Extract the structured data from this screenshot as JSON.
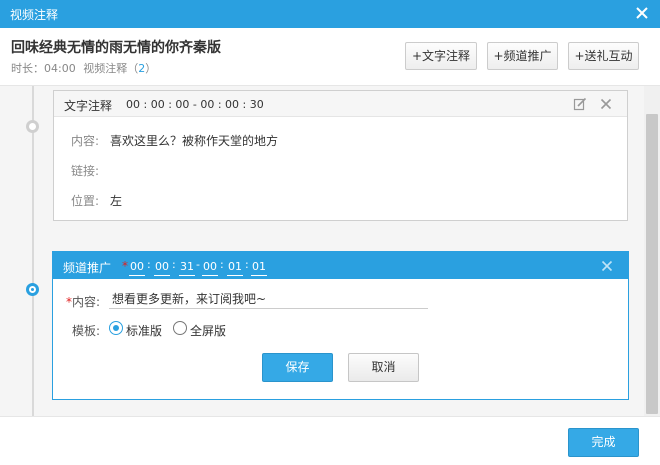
{
  "dialog": {
    "title": "视频注释",
    "close_icon": "close-icon"
  },
  "header": {
    "video_title": "回味经典无情的雨无情的你齐秦版",
    "duration_label": "时长：",
    "duration": "04:00",
    "annotation_label": "视频注释（",
    "annotation_count": "2",
    "annotation_close": "）",
    "buttons": {
      "text_annotation": "+文字注释",
      "channel_promo": "+频道推广",
      "gift_interact": "+送礼互动"
    }
  },
  "annotations": [
    {
      "type_label": "文字注释",
      "time_range": "00 : 00 : 00 - 00 : 00 : 30",
      "rows": [
        {
          "label": "内容:",
          "value": "喜欢这里么？被称作天堂的地方"
        },
        {
          "label": "链接:",
          "value": ""
        },
        {
          "label": "位置:",
          "value": "左"
        }
      ]
    },
    {
      "type_label": "频道推广",
      "required_mark": "*",
      "time": {
        "start_h": "00",
        "start_m": "00",
        "start_s": "31",
        "end_h": "00",
        "end_m": "01",
        "end_s": "01",
        "colon": ":",
        "dash": "-"
      },
      "content_label": "内容:",
      "content_value": "想看更多更新，来订阅我吧~",
      "template_label": "模板:",
      "template_options": [
        "标准版",
        "全屏版"
      ],
      "template_selected": "标准版",
      "save_label": "保存",
      "cancel_label": "取消"
    }
  ],
  "footer": {
    "done_label": "完成"
  },
  "colors": {
    "accent": "#2aa0e0",
    "required": "#e02020"
  }
}
